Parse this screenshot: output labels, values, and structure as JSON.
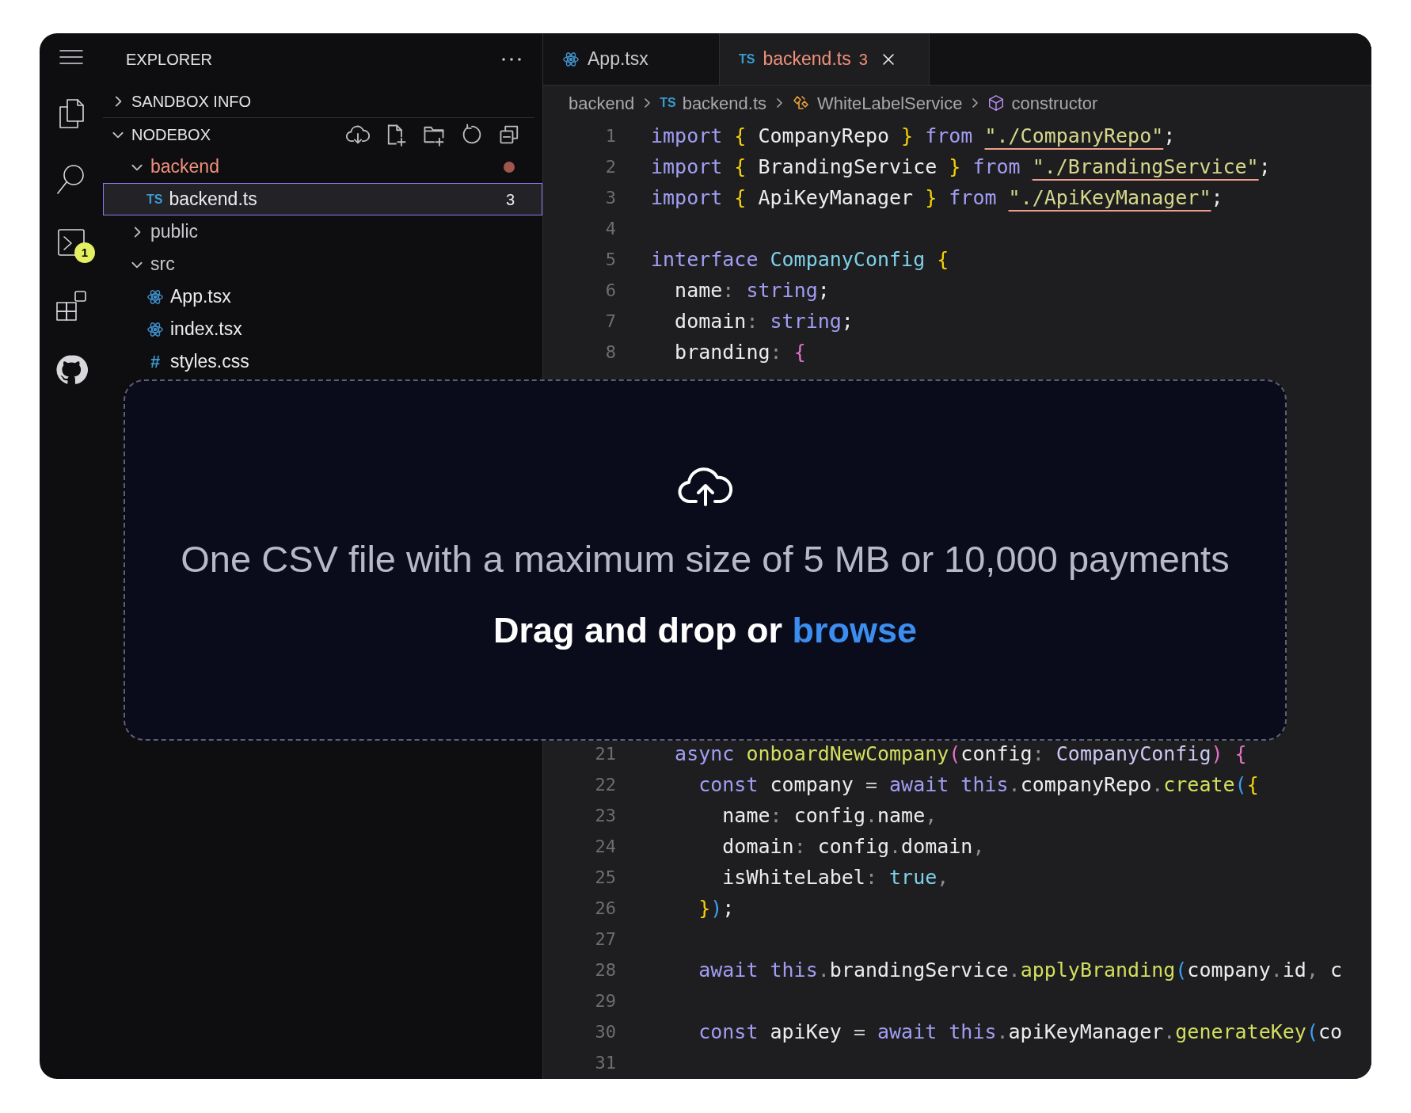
{
  "activity_bar": [
    {
      "kind": "menu"
    },
    {
      "kind": "files"
    },
    {
      "kind": "search"
    },
    {
      "kind": "terminal",
      "badge": "1"
    },
    {
      "kind": "extensions"
    },
    {
      "kind": "cat"
    }
  ],
  "explorer": {
    "title": "EXPLORER",
    "sections": [
      {
        "label": "SANDBOX INFO",
        "expanded": false
      },
      {
        "label": "NODEBOX",
        "expanded": true,
        "actions": [
          {
            "kind": "cloud-download"
          },
          {
            "kind": "new-file"
          },
          {
            "kind": "new-folder"
          },
          {
            "kind": "refresh"
          },
          {
            "kind": "collapse"
          }
        ],
        "items": [
          {
            "kind": "folder",
            "label": "backend",
            "expanded": true,
            "modified": true,
            "selected": false,
            "children": [
              {
                "kind": "ts-file",
                "icon_text": "TS",
                "label": "backend.ts",
                "badge": "3",
                "selected": true
              }
            ]
          },
          {
            "kind": "folder",
            "label": "public",
            "expanded": false,
            "modified": false,
            "selected": false
          },
          {
            "kind": "folder",
            "label": "src",
            "expanded": true,
            "modified": false,
            "selected": false,
            "children": [
              {
                "kind": "react-file",
                "label": "App.tsx",
                "selected": false
              },
              {
                "kind": "react-file",
                "label": "index.tsx",
                "selected": false
              },
              {
                "kind": "css-file",
                "icon_text": "#",
                "label": "styles.css",
                "selected": false
              }
            ]
          }
        ]
      }
    ]
  },
  "tabs": [
    {
      "label": "App.tsx",
      "kind": "react-file",
      "selected": false
    },
    {
      "label": "backend.ts",
      "kind": "ts-file",
      "icon_text": "TS",
      "badge": "3",
      "selected": true
    }
  ],
  "breadcrumbs": [
    {
      "label": "backend",
      "kind": "folder"
    },
    {
      "label": "backend.ts",
      "kind": "ts",
      "icon_text": "TS"
    },
    {
      "label": "WhiteLabelService",
      "kind": "class"
    },
    {
      "label": "constructor",
      "kind": "method"
    }
  ],
  "code": [
    {
      "number": "1",
      "tokens": [
        {
          "text": "import ",
          "kind": "kw"
        },
        {
          "text": "{",
          "kind": "b1"
        },
        {
          "text": " CompanyRepo ",
          "kind": "id"
        },
        {
          "text": "}",
          "kind": "b1"
        },
        {
          "text": " from ",
          "kind": "kw"
        },
        {
          "text": "\"./CompanyRepo\"",
          "kind": "str-err"
        },
        {
          "text": ";",
          "kind": "id"
        }
      ]
    },
    {
      "number": "2",
      "tokens": [
        {
          "text": "import ",
          "kind": "kw"
        },
        {
          "text": "{",
          "kind": "b1"
        },
        {
          "text": " BrandingService ",
          "kind": "id"
        },
        {
          "text": "}",
          "kind": "b1"
        },
        {
          "text": " from ",
          "kind": "kw"
        },
        {
          "text": "\"./BrandingService\"",
          "kind": "str-err"
        },
        {
          "text": ";",
          "kind": "id"
        }
      ]
    },
    {
      "number": "3",
      "tokens": [
        {
          "text": "import ",
          "kind": "kw"
        },
        {
          "text": "{",
          "kind": "b1"
        },
        {
          "text": " ApiKeyManager ",
          "kind": "id"
        },
        {
          "text": "}",
          "kind": "b1"
        },
        {
          "text": " from ",
          "kind": "kw"
        },
        {
          "text": "\"./ApiKeyManager\"",
          "kind": "str-err"
        },
        {
          "text": ";",
          "kind": "id"
        }
      ]
    },
    {
      "number": "4"
    },
    {
      "number": "5",
      "tokens": [
        {
          "text": "interface ",
          "kind": "kw"
        },
        {
          "text": "CompanyConfig ",
          "kind": "type"
        },
        {
          "text": "{",
          "kind": "b1"
        }
      ]
    },
    {
      "number": "6",
      "tokens": [
        {
          "text": "  name",
          "kind": "id"
        },
        {
          "text": ": ",
          "kind": "punct"
        },
        {
          "text": "string",
          "kind": "kw"
        },
        {
          "text": ";",
          "kind": "id"
        }
      ]
    },
    {
      "number": "7",
      "tokens": [
        {
          "text": "  domain",
          "kind": "id"
        },
        {
          "text": ": ",
          "kind": "punct"
        },
        {
          "text": "string",
          "kind": "kw"
        },
        {
          "text": ";",
          "kind": "id"
        }
      ]
    },
    {
      "number": "8",
      "tokens": [
        {
          "text": "  branding",
          "kind": "id"
        },
        {
          "text": ": ",
          "kind": "punct"
        },
        {
          "text": "{",
          "kind": "b2"
        }
      ]
    },
    {
      "number": "21",
      "tokens": [
        {
          "text": "  async ",
          "kind": "kw"
        },
        {
          "text": "onboardNewCompany",
          "kind": "fn"
        },
        {
          "text": "(",
          "kind": "b2"
        },
        {
          "text": "config",
          "kind": "id"
        },
        {
          "text": ": ",
          "kind": "punct"
        },
        {
          "text": "CompanyConfig",
          "kind": "typeref"
        },
        {
          "text": ") {",
          "kind": "b2"
        }
      ]
    },
    {
      "number": "22",
      "tokens": [
        {
          "text": "    const ",
          "kind": "kw"
        },
        {
          "text": "company ",
          "kind": "id"
        },
        {
          "text": "= ",
          "kind": "op"
        },
        {
          "text": "await this",
          "kind": "kw"
        },
        {
          "text": ".",
          "kind": "punct"
        },
        {
          "text": "companyRepo",
          "kind": "id"
        },
        {
          "text": ".",
          "kind": "punct"
        },
        {
          "text": "create",
          "kind": "fn"
        },
        {
          "text": "(",
          "kind": "b3"
        },
        {
          "text": "{",
          "kind": "b1"
        }
      ]
    },
    {
      "number": "23",
      "tokens": [
        {
          "text": "      name",
          "kind": "id"
        },
        {
          "text": ": ",
          "kind": "punct"
        },
        {
          "text": "config",
          "kind": "id"
        },
        {
          "text": ".",
          "kind": "punct"
        },
        {
          "text": "name",
          "kind": "id"
        },
        {
          "text": ",",
          "kind": "punct"
        }
      ]
    },
    {
      "number": "24",
      "tokens": [
        {
          "text": "      domain",
          "kind": "id"
        },
        {
          "text": ": ",
          "kind": "punct"
        },
        {
          "text": "config",
          "kind": "id"
        },
        {
          "text": ".",
          "kind": "punct"
        },
        {
          "text": "domain",
          "kind": "id"
        },
        {
          "text": ",",
          "kind": "punct"
        }
      ]
    },
    {
      "number": "25",
      "tokens": [
        {
          "text": "      isWhiteLabel",
          "kind": "id"
        },
        {
          "text": ": ",
          "kind": "punct"
        },
        {
          "text": "true",
          "kind": "bool"
        },
        {
          "text": ",",
          "kind": "punct"
        }
      ]
    },
    {
      "number": "26",
      "tokens": [
        {
          "text": "    }",
          "kind": "b1"
        },
        {
          "text": ")",
          "kind": "b3"
        },
        {
          "text": ";",
          "kind": "id"
        }
      ]
    },
    {
      "number": "27"
    },
    {
      "number": "28",
      "tokens": [
        {
          "text": "    await this",
          "kind": "kw"
        },
        {
          "text": ".",
          "kind": "punct"
        },
        {
          "text": "brandingService",
          "kind": "id"
        },
        {
          "text": ".",
          "kind": "punct"
        },
        {
          "text": "applyBranding",
          "kind": "fn"
        },
        {
          "text": "(",
          "kind": "b3"
        },
        {
          "text": "company",
          "kind": "id"
        },
        {
          "text": ".",
          "kind": "punct"
        },
        {
          "text": "id",
          "kind": "id"
        },
        {
          "text": ", ",
          "kind": "punct"
        },
        {
          "text": "c",
          "kind": "id"
        }
      ]
    },
    {
      "number": "29"
    },
    {
      "number": "30",
      "tokens": [
        {
          "text": "    const ",
          "kind": "kw"
        },
        {
          "text": "apiKey ",
          "kind": "id"
        },
        {
          "text": "= ",
          "kind": "op"
        },
        {
          "text": "await this",
          "kind": "kw"
        },
        {
          "text": ".",
          "kind": "punct"
        },
        {
          "text": "apiKeyManager",
          "kind": "id"
        },
        {
          "text": ".",
          "kind": "punct"
        },
        {
          "text": "generateKey",
          "kind": "fn"
        },
        {
          "text": "(",
          "kind": "b3"
        },
        {
          "text": "co",
          "kind": "id"
        }
      ]
    },
    {
      "number": "31"
    }
  ],
  "drop_zone": {
    "hint": "One CSV file with a maximum size of 5 MB or 10,000 payments",
    "prompt": "Drag and drop or ",
    "link": "browse"
  }
}
